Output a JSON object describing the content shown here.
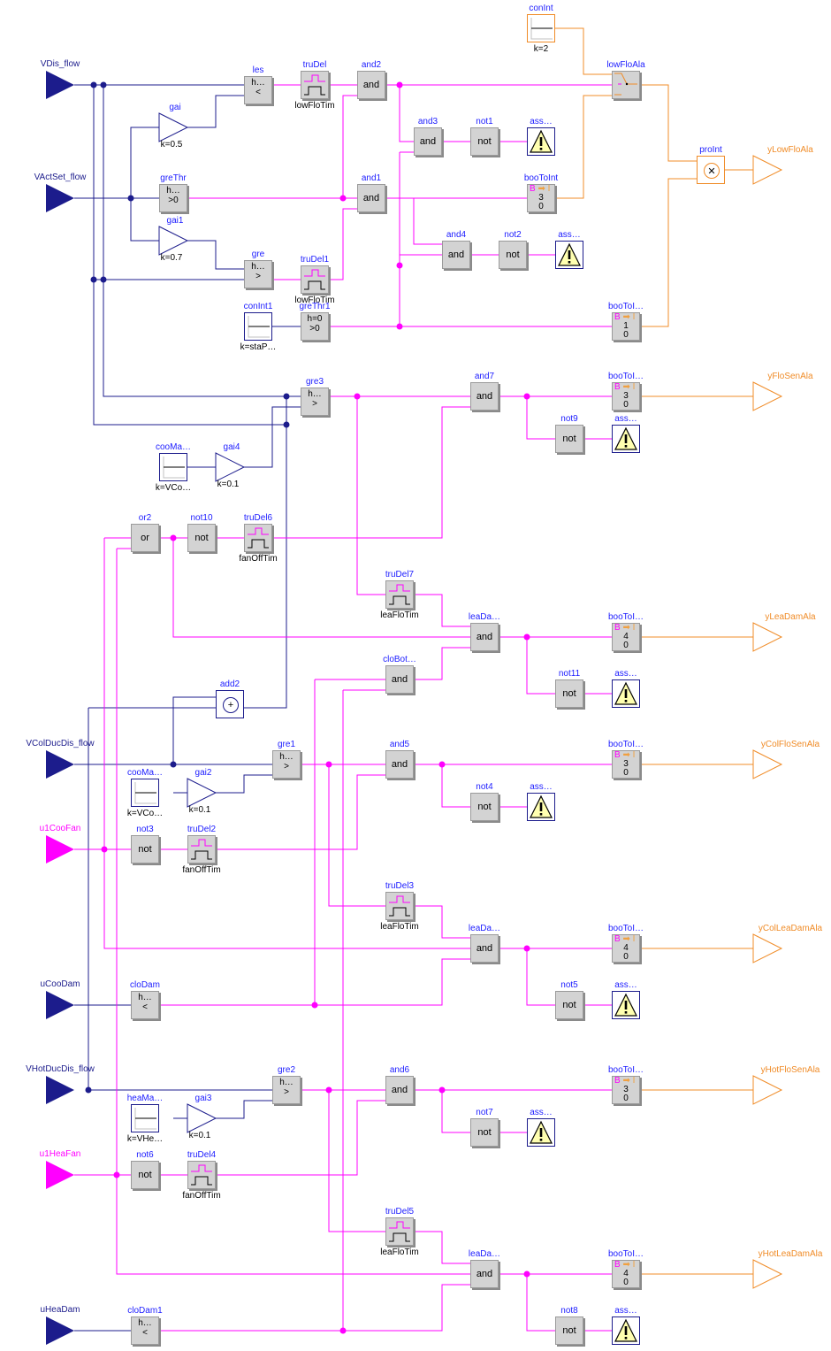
{
  "colors": {
    "real_signal": "#1c1c8c",
    "boolean_signal": "#ff00ff",
    "integer_signal": "#f08c28",
    "block_label": "#1c1cff",
    "block_fill": "#d3d3d3",
    "assert_fill": "#ffffb0"
  },
  "inputs": [
    {
      "id": "VDis_flow",
      "label": "VDis_flow",
      "type": "real"
    },
    {
      "id": "VActSet_flow",
      "label": "VActSet_flow",
      "type": "real"
    },
    {
      "id": "VColDucDis_flow",
      "label": "VColDucDis_flow",
      "type": "real"
    },
    {
      "id": "u1CooFan",
      "label": "u1CooFan",
      "type": "boolean"
    },
    {
      "id": "uCooDam",
      "label": "uCooDam",
      "type": "real"
    },
    {
      "id": "VHotDucDis_flow",
      "label": "VHotDucDis_flow",
      "type": "real"
    },
    {
      "id": "u1HeaFan",
      "label": "u1HeaFan",
      "type": "boolean"
    },
    {
      "id": "uHeaDam",
      "label": "uHeaDam",
      "type": "real"
    }
  ],
  "outputs": [
    {
      "id": "yLowFloAla",
      "label": "yLowFloAla"
    },
    {
      "id": "yFloSenAla",
      "label": "yFloSenAla"
    },
    {
      "id": "yLeaDamAla",
      "label": "yLeaDamAla"
    },
    {
      "id": "yColFloSenAla",
      "label": "yColFloSenAla"
    },
    {
      "id": "yColLeaDamAla",
      "label": "yColLeaDamAla"
    },
    {
      "id": "yHotFloSenAla",
      "label": "yHotFloSenAla"
    },
    {
      "id": "yHotLeaDamAla",
      "label": "yHotLeaDamAla"
    }
  ],
  "blocks": {
    "les": {
      "name": "les",
      "top": "h…",
      "symbol": "<"
    },
    "truDel": {
      "name": "truDel",
      "param": "lowFloTim"
    },
    "and2": {
      "name": "and2",
      "symbol": "and"
    },
    "gai": {
      "name": "gai",
      "param": "k=0.5"
    },
    "and3": {
      "name": "and3",
      "symbol": "and"
    },
    "not1": {
      "name": "not1",
      "symbol": "not"
    },
    "ass1": {
      "name": "ass…"
    },
    "greThr": {
      "name": "greThr",
      "top": "h…",
      "symbol": ">0"
    },
    "and1": {
      "name": "and1",
      "symbol": "and"
    },
    "booToInt": {
      "name": "booToInt",
      "hdr_b": "B",
      "hdr_arrow": "➡ I",
      "v1": "3",
      "v2": "0"
    },
    "gai1": {
      "name": "gai1",
      "param": "k=0.7"
    },
    "and4": {
      "name": "and4",
      "symbol": "and"
    },
    "not2": {
      "name": "not2",
      "symbol": "not"
    },
    "ass2": {
      "name": "ass…"
    },
    "gre": {
      "name": "gre",
      "top": "h…",
      "symbol": ">"
    },
    "truDel1": {
      "name": "truDel1",
      "param": "lowFloTim"
    },
    "conInt1": {
      "name": "conInt1",
      "param": "k=staP…"
    },
    "greThr1": {
      "name": "greThr1",
      "top": "h=0",
      "symbol": ">0"
    },
    "booToI1": {
      "name": "booToI…",
      "hdr_b": "B",
      "hdr_arrow": "➡ I",
      "v1": "1",
      "v2": "0"
    },
    "conInt": {
      "name": "conInt",
      "param": "k=2"
    },
    "lowFloAla": {
      "name": "lowFloAla"
    },
    "proInt": {
      "name": "proInt",
      "symbol": "✕"
    },
    "gre3": {
      "name": "gre3",
      "top": "h…",
      "symbol": ">"
    },
    "and7": {
      "name": "and7",
      "symbol": "and"
    },
    "booToI2": {
      "name": "booToI…",
      "hdr_b": "B",
      "hdr_arrow": "➡ I",
      "v1": "3",
      "v2": "0"
    },
    "not9": {
      "name": "not9",
      "symbol": "not"
    },
    "ass3": {
      "name": "ass…"
    },
    "cooMa1": {
      "name": "cooMa…",
      "param": "k=VCo…"
    },
    "gai4": {
      "name": "gai4",
      "param": "k=0.1"
    },
    "or2": {
      "name": "or2",
      "symbol": "or"
    },
    "not10": {
      "name": "not10",
      "symbol": "not"
    },
    "truDel6": {
      "name": "truDel6",
      "param": "fanOffTim"
    },
    "truDel7": {
      "name": "truDel7",
      "param": "leaFloTim"
    },
    "leaDa1": {
      "name": "leaDa…",
      "symbol": "and"
    },
    "booToI3": {
      "name": "booToI…",
      "hdr_b": "B",
      "hdr_arrow": "➡ I",
      "v1": "4",
      "v2": "0"
    },
    "not11": {
      "name": "not11",
      "symbol": "not"
    },
    "ass4": {
      "name": "ass…"
    },
    "cloBot": {
      "name": "cloBot…",
      "symbol": "and"
    },
    "add2": {
      "name": "add2",
      "symbol": "+"
    },
    "gre1": {
      "name": "gre1",
      "top": "h…",
      "symbol": ">"
    },
    "and5": {
      "name": "and5",
      "symbol": "and"
    },
    "booToI4": {
      "name": "booToI…",
      "hdr_b": "B",
      "hdr_arrow": "➡ I",
      "v1": "3",
      "v2": "0"
    },
    "not4": {
      "name": "not4",
      "symbol": "not"
    },
    "ass5": {
      "name": "ass…"
    },
    "cooMa2": {
      "name": "cooMa…",
      "param": "k=VCo…"
    },
    "gai2": {
      "name": "gai2",
      "param": "k=0.1"
    },
    "not3": {
      "name": "not3",
      "symbol": "not"
    },
    "truDel2": {
      "name": "truDel2",
      "param": "fanOffTim"
    },
    "truDel3": {
      "name": "truDel3",
      "param": "leaFloTim"
    },
    "leaDa2": {
      "name": "leaDa…",
      "symbol": "and"
    },
    "booToI5": {
      "name": "booToI…",
      "hdr_b": "B",
      "hdr_arrow": "➡ I",
      "v1": "4",
      "v2": "0"
    },
    "not5": {
      "name": "not5",
      "symbol": "not"
    },
    "ass6": {
      "name": "ass…"
    },
    "cloDam": {
      "name": "cloDam",
      "top": "h…",
      "symbol": "<"
    },
    "gre2": {
      "name": "gre2",
      "top": "h…",
      "symbol": ">"
    },
    "and6": {
      "name": "and6",
      "symbol": "and"
    },
    "booToI6": {
      "name": "booToI…",
      "hdr_b": "B",
      "hdr_arrow": "➡ I",
      "v1": "3",
      "v2": "0"
    },
    "not7": {
      "name": "not7",
      "symbol": "not"
    },
    "ass7": {
      "name": "ass…"
    },
    "heaMa": {
      "name": "heaMa…",
      "param": "k=VHe…"
    },
    "gai3": {
      "name": "gai3",
      "param": "k=0.1"
    },
    "not6": {
      "name": "not6",
      "symbol": "not"
    },
    "truDel4": {
      "name": "truDel4",
      "param": "fanOffTim"
    },
    "truDel5": {
      "name": "truDel5",
      "param": "leaFloTim"
    },
    "leaDa3": {
      "name": "leaDa…",
      "symbol": "and"
    },
    "booToI7": {
      "name": "booToI…",
      "hdr_b": "B",
      "hdr_arrow": "➡ I",
      "v1": "4",
      "v2": "0"
    },
    "not8": {
      "name": "not8",
      "symbol": "not"
    },
    "ass8": {
      "name": "ass…"
    },
    "cloDam1": {
      "name": "cloDam1",
      "top": "h…",
      "symbol": "<"
    }
  }
}
